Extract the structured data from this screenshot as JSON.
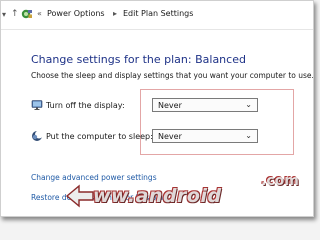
{
  "breadcrumb": {
    "overflow": "«",
    "items": [
      "Power Options",
      "Edit Plan Settings"
    ]
  },
  "main": {
    "heading": "Change settings for the plan: Balanced",
    "description": "Choose the sleep and display settings that you want your computer to use.",
    "settings": [
      {
        "label": "Turn off the display:",
        "value": "Never",
        "icon": "monitor-icon"
      },
      {
        "label": "Put the computer to sleep:",
        "value": "Never",
        "icon": "moon-sleep-icon"
      }
    ],
    "links": [
      "Change advanced power settings",
      "Restore default settings for this plan"
    ]
  },
  "watermark": {
    "text": "ww.android",
    "suffix": ".com"
  },
  "colors": {
    "heading": "#1e3287",
    "link": "#1f5aa6",
    "highlight_border": "#e3a6a6"
  }
}
